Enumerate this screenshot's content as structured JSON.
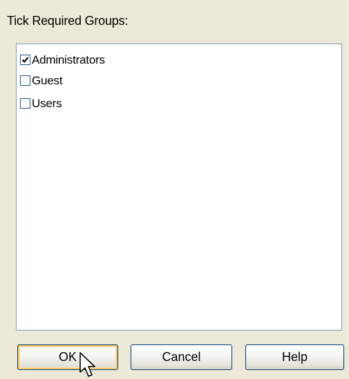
{
  "dialog": {
    "prompt": "Tick Required Groups:"
  },
  "groups": [
    {
      "label": "Administrators",
      "checked": true
    },
    {
      "label": "Guest",
      "checked": false
    },
    {
      "label": "Users",
      "checked": false
    }
  ],
  "buttons": {
    "ok_label": "OK",
    "cancel_label": "Cancel",
    "help_label": "Help"
  },
  "icons": {
    "cursor": "arrow-pointer-icon",
    "check": "checkmark-icon"
  },
  "colors": {
    "dialog_bg": "#ece9d8",
    "list_border": "#7f9db9",
    "button_border": "#003c74",
    "focus_highlight": "#f9c86b"
  }
}
